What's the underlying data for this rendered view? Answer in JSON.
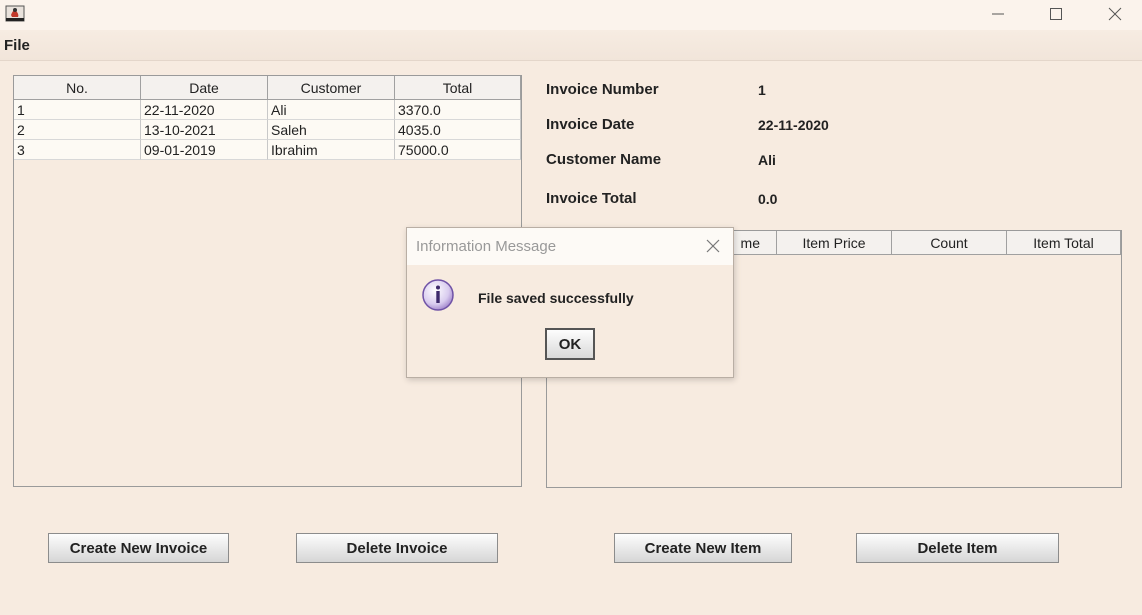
{
  "window": {
    "icon": "java-app-icon",
    "minimize": "minimize-icon",
    "maximize": "maximize-icon",
    "close": "close-icon"
  },
  "menu": {
    "file": "File"
  },
  "invoices_table": {
    "headers": [
      "No.",
      "Date",
      "Customer",
      "Total"
    ],
    "rows": [
      [
        "1",
        "22-11-2020",
        "Ali",
        "3370.0"
      ],
      [
        "2",
        "13-10-2021",
        "Saleh",
        "4035.0"
      ],
      [
        "3",
        "09-01-2019",
        "Ibrahim",
        "75000.0"
      ]
    ]
  },
  "details": {
    "invoice_number_label": "Invoice Number",
    "invoice_number": "1",
    "invoice_date_label": "Invoice Date",
    "invoice_date": "22-11-2020",
    "customer_name_label": "Customer Name",
    "customer_name": "Ali",
    "invoice_total_label": "Invoice Total",
    "invoice_total": "0.0"
  },
  "items_table": {
    "headers": [
      "me",
      "Item Price",
      "Count",
      "Item Total"
    ]
  },
  "buttons": {
    "create_invoice": "Create New Invoice",
    "delete_invoice": "Delete Invoice",
    "create_item": "Create New Item",
    "delete_item": "Delete Item"
  },
  "dialog": {
    "title": "Information Message",
    "message": "File saved successfully",
    "ok": "OK",
    "icon": "info-icon",
    "accent": "#a98fd0"
  }
}
